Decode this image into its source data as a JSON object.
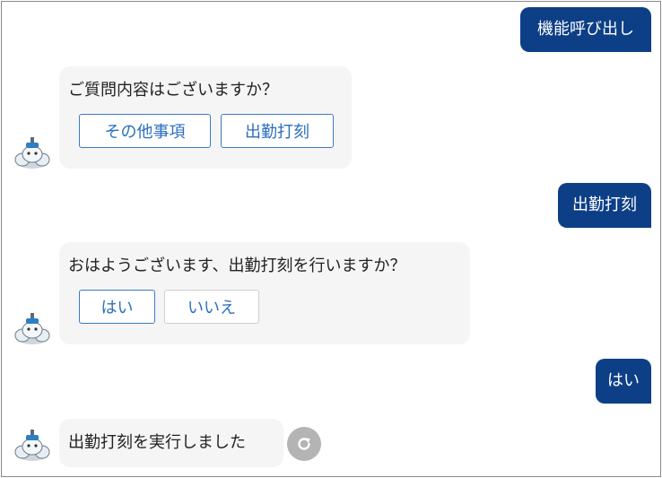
{
  "chat": {
    "messages": [
      {
        "role": "user",
        "text": "機能呼び出し"
      },
      {
        "role": "bot",
        "text": "ご質問内容はございますか？",
        "choices": [
          "その他事項",
          "出勤打刻"
        ]
      },
      {
        "role": "user",
        "text": "出勤打刻"
      },
      {
        "role": "bot",
        "text": "おはようございます、出勤打刻を行いますか？",
        "choices": [
          "はい",
          "いいえ"
        ]
      },
      {
        "role": "user",
        "text": "はい"
      },
      {
        "role": "bot",
        "text": "出勤打刻を実行しました"
      }
    ]
  },
  "colors": {
    "user_bubble": "#0d3f87",
    "bot_bubble": "#f5f5f5",
    "choice_border_active": "#3a7bc8",
    "choice_border_default": "#cfcfcf",
    "choice_text": "#2c6fbd",
    "refresh_button": "#b4b4b4"
  },
  "icons": {
    "bot_avatar": "robot-avatar-icon",
    "refresh": "refresh-icon"
  }
}
